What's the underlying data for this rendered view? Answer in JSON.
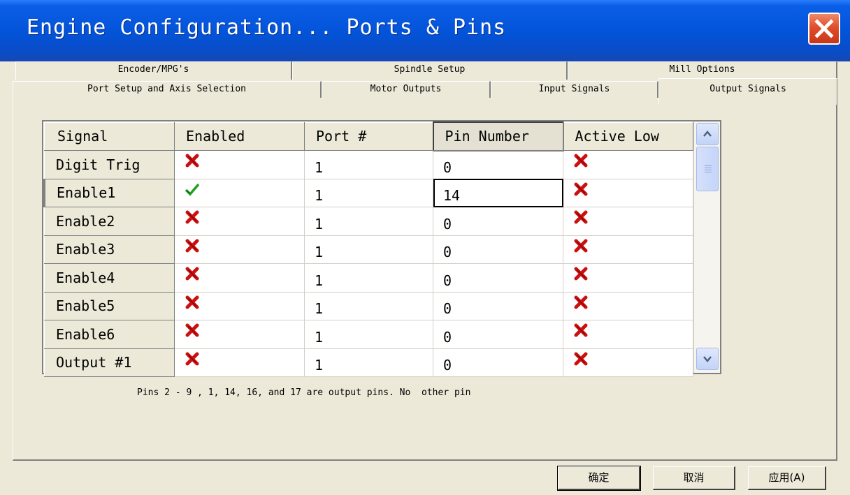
{
  "window": {
    "title": "Engine Configuration... Ports & Pins"
  },
  "tabs": {
    "top_row": [
      "Encoder/MPG's",
      "Spindle Setup",
      "Mill Options"
    ],
    "bottom_row": [
      "Port Setup and Axis Selection",
      "Motor Outputs",
      "Input Signals",
      "Output Signals"
    ],
    "active": "Output Signals"
  },
  "grid": {
    "columns": [
      "Signal",
      "Enabled",
      "Port #",
      "Pin Number",
      "Active Low"
    ],
    "rows": [
      {
        "signal": "Digit  Trig",
        "enabled": false,
        "port": "1",
        "pin": "0",
        "active_low": false
      },
      {
        "signal": "Enable1",
        "enabled": true,
        "port": "1",
        "pin": "14",
        "active_low": false
      },
      {
        "signal": "Enable2",
        "enabled": false,
        "port": "1",
        "pin": "0",
        "active_low": false
      },
      {
        "signal": "Enable3",
        "enabled": false,
        "port": "1",
        "pin": "0",
        "active_low": false
      },
      {
        "signal": "Enable4",
        "enabled": false,
        "port": "1",
        "pin": "0",
        "active_low": false
      },
      {
        "signal": "Enable5",
        "enabled": false,
        "port": "1",
        "pin": "0",
        "active_low": false
      },
      {
        "signal": "Enable6",
        "enabled": false,
        "port": "1",
        "pin": "0",
        "active_low": false
      },
      {
        "signal": "Output #1",
        "enabled": false,
        "port": "1",
        "pin": "0",
        "active_low": false
      }
    ]
  },
  "help_text": "Pins 2 - 9 , 1, 14, 16, and 17 are output pins. No  other pin",
  "buttons": {
    "ok": "确定",
    "cancel": "取消",
    "apply": "应用(A)"
  },
  "icons": {
    "enabled_true": "green-check-icon",
    "enabled_false": "red-x-icon"
  },
  "colors": {
    "title_bar": "#0353d8",
    "close_button": "#e04e2a",
    "check": "#1fa01f",
    "cross": "#cc1010"
  }
}
